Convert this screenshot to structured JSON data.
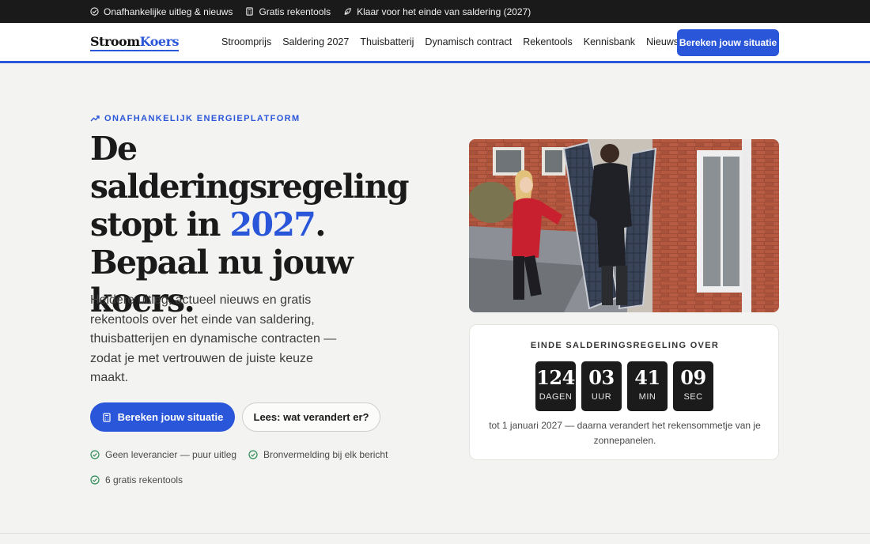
{
  "topbar": {
    "items": [
      {
        "icon": "shield-check-icon",
        "label": "Onafhankelijke uitleg & nieuws"
      },
      {
        "icon": "calculator-icon",
        "label": "Gratis rekentools"
      },
      {
        "icon": "leaf-icon",
        "label": "Klaar voor het einde van saldering (2027)"
      }
    ]
  },
  "nav": {
    "logo_part1": "Stroom",
    "logo_part2": "Koers",
    "links": [
      "Stroomprijs",
      "Saldering 2027",
      "Thuisbatterij",
      "Dynamisch contract",
      "Rekentools",
      "Kennisbank",
      "Nieuws"
    ],
    "cta": "Bereken jouw situatie"
  },
  "hero": {
    "eyebrow": "ONAFHANKELIJK ENERGIEPLATFORM",
    "headline_pre": "De salderingsregeling stopt in ",
    "headline_accent": "2027",
    "headline_post": ". Bepaal nu jouw koers.",
    "lede": "Heldere uitleg, actueel nieuws en gratis rekentools over het einde van saldering, thuisbatterijen en dynamische contracten — zodat je met vertrouwen de juiste keuze maakt.",
    "primary_cta": "Bereken jouw situatie",
    "secondary_cta": "Lees: wat verandert er?",
    "checks": [
      "Geen leverancier — puur uitleg",
      "Bronvermelding bij elk bericht",
      "6 gratis rekentools"
    ]
  },
  "countdown": {
    "title": "EINDE SALDERINGSREGELING OVER",
    "units": [
      {
        "value": "124",
        "label": "DAGEN"
      },
      {
        "value": "03",
        "label": "UUR"
      },
      {
        "value": "41",
        "label": "MIN"
      },
      {
        "value": "09",
        "label": "SEC"
      }
    ],
    "note": "tot 1 januari 2027 — daarna verandert het rekensommetje van je zonnepanelen."
  },
  "colors": {
    "accent": "#2a56d9",
    "topbar_bg": "#1a1a1a",
    "page_bg": "#f3f3f1",
    "check_green": "#2e8b57"
  }
}
